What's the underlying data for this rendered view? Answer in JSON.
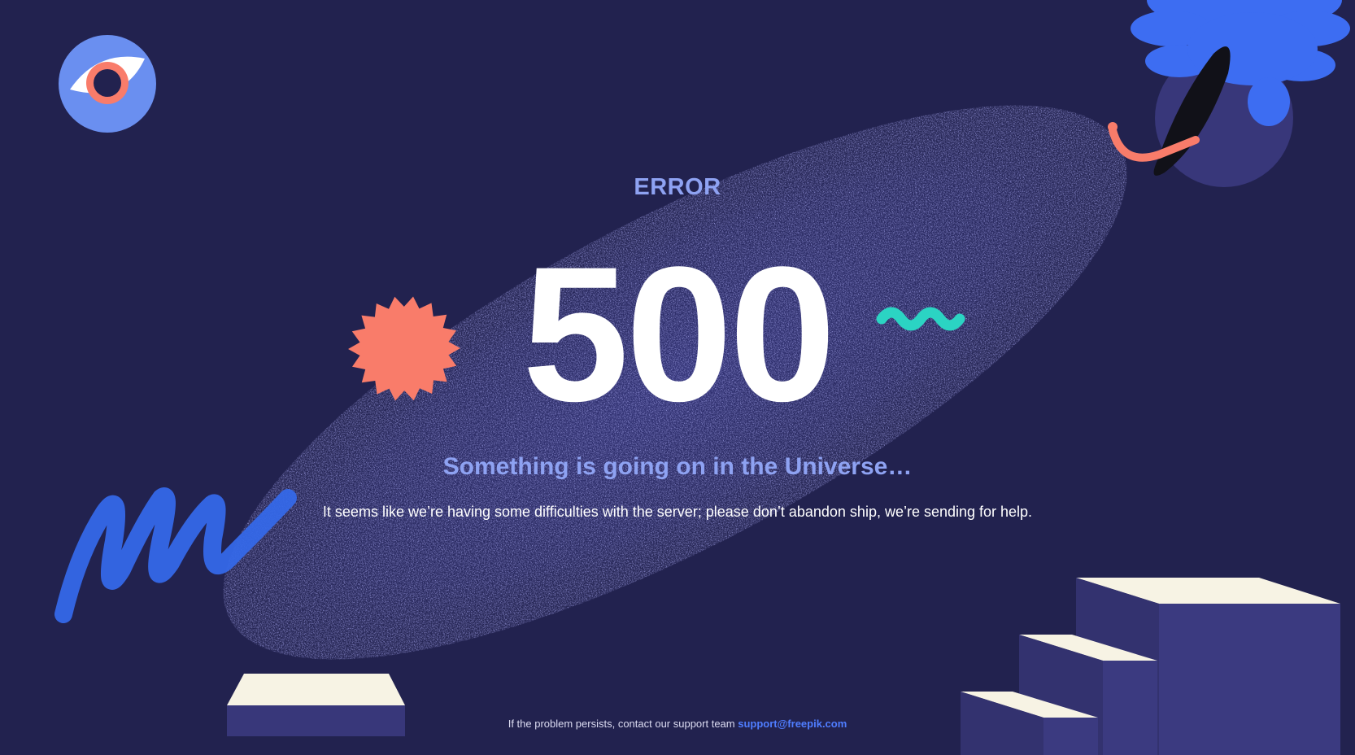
{
  "error": {
    "label": "ERROR",
    "code": "500",
    "headline": "Something is going on in the Universe…",
    "message": "It seems like we’re having some difficulties with the server; please don’t abandon ship, we’re sending for help."
  },
  "footer": {
    "text": "If the problem persists, contact our support team",
    "email": "support@freepik.com"
  },
  "colors": {
    "background": "#22224f",
    "accent_blue": "#8ea2f2",
    "link_blue": "#4f7dff",
    "coral": "#f97c6a",
    "teal": "#2bd4c3",
    "stairs": "#38377a",
    "stairs_top": "#f7f3e4"
  },
  "icons": [
    "eye-icon",
    "starburst-icon",
    "squiggle-icon",
    "flower-planet-icon",
    "scribble-icon"
  ]
}
